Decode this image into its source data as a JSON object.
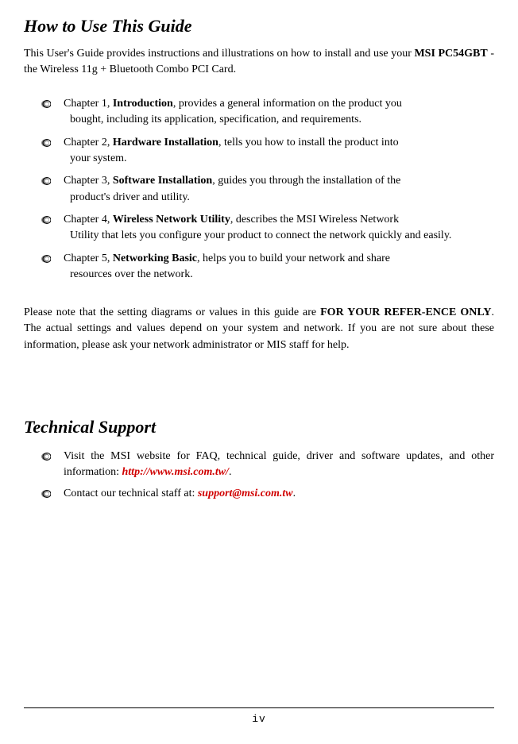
{
  "section1": {
    "heading": "How to Use This Guide",
    "intro_p1": "This User's Guide provides instructions and illustrations on how to install and use your ",
    "intro_bold": "MSI PC54GBT",
    "intro_p2": " - the Wireless 11g + Bluetooth Combo PCI Card.",
    "chapters": [
      {
        "prefix": "Chapter 1, ",
        "bold": "Introduction",
        "rest1": ", provides a general information on the product you",
        "rest2": "bought, including its application, specification, and requirements."
      },
      {
        "prefix": "Chapter 2, ",
        "bold": "Hardware Installation",
        "rest1": ", tells you how to install the product into",
        "rest2": "your system."
      },
      {
        "prefix": "Chapter 3, ",
        "bold": "Software Installation",
        "rest1": ", guides you through the installation of the",
        "rest2": "product's driver and utility."
      },
      {
        "prefix": "Chapter 4, ",
        "bold": "Wireless Network Utility",
        "rest1": ", describes the MSI Wireless Network",
        "rest2": "Utility that lets you configure your product to connect the network quickly and easily."
      },
      {
        "prefix": "Chapter 5, ",
        "bold": "Networking Basic",
        "rest1": ", helps you to build your network and share",
        "rest2": "resources over the network."
      }
    ],
    "note_p1": "Please note that the setting diagrams or values in this guide are ",
    "note_bold": "FOR YOUR REFER-ENCE ONLY",
    "note_p2": ".  The actual settings and values depend on your system and network.  If you are not sure about these information, please ask your network administrator or MIS staff for help."
  },
  "section2": {
    "heading": "Technical Support",
    "item1_p1": "Visit the MSI website for FAQ, technical guide, driver and software updates,",
    "item1_p2a": "and other information: ",
    "item1_link": "http://www.msi.com.tw/",
    "item1_p2b": ".",
    "item2_p1": "Contact our technical staff at: ",
    "item2_link": "support@msi.com.tw",
    "item2_p2": "."
  },
  "page_number": "iv"
}
